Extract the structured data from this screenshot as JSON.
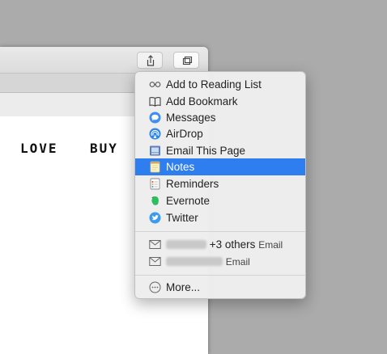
{
  "page": {
    "nav_love": "LOVE",
    "nav_buy": "BUY"
  },
  "toolbar": {
    "share_icon": "share-icon",
    "tabs_icon": "tab-overview-icon"
  },
  "menu": {
    "items": [
      {
        "label": "Add to Reading List",
        "icon": "reading-list-icon"
      },
      {
        "label": "Add Bookmark",
        "icon": "bookmark-icon"
      },
      {
        "label": "Messages",
        "icon": "messages-icon"
      },
      {
        "label": "AirDrop",
        "icon": "airdrop-icon"
      },
      {
        "label": "Email This Page",
        "icon": "email-page-icon"
      },
      {
        "label": "Notes",
        "icon": "notes-icon",
        "selected": true
      },
      {
        "label": "Reminders",
        "icon": "reminders-icon"
      },
      {
        "label": "Evernote",
        "icon": "evernote-icon"
      },
      {
        "label": "Twitter",
        "icon": "twitter-icon"
      }
    ],
    "recent": [
      {
        "others": "+3 others",
        "type": "Email",
        "icon": "envelope-icon"
      },
      {
        "others": "",
        "type": "Email",
        "icon": "envelope-icon"
      }
    ],
    "more_label": "More...",
    "more_icon": "more-icon"
  },
  "colors": {
    "selection": "#2f7ef0",
    "background": "#ababab"
  }
}
